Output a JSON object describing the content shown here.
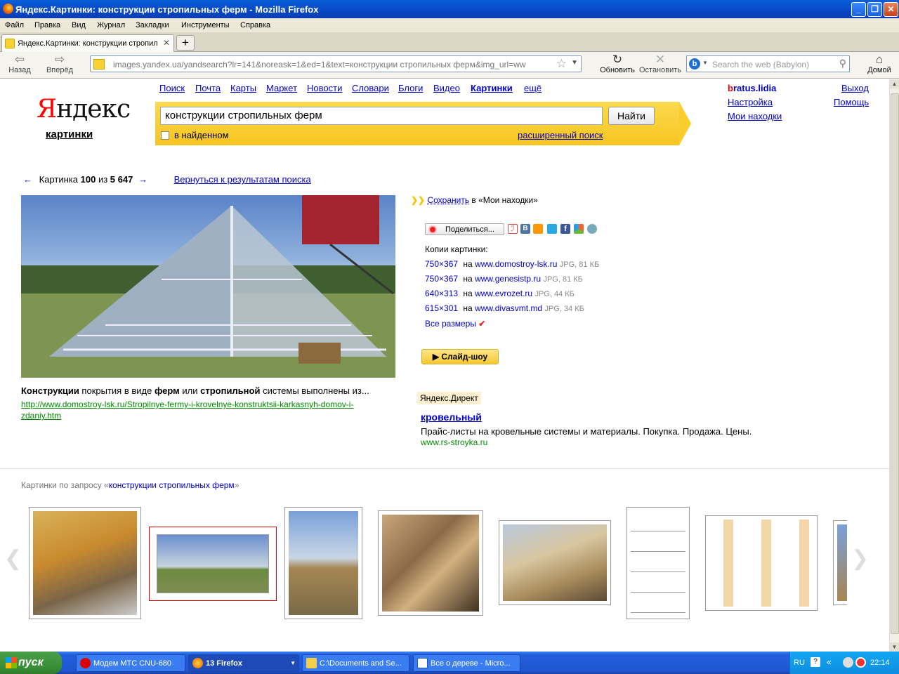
{
  "window": {
    "title": "Яндекс.Картинки: конструкции стропильных ферм - Mozilla Firefox",
    "btn_min": "_",
    "btn_max": "❐",
    "btn_close": "✕"
  },
  "menu": [
    "Файл",
    "Правка",
    "Вид",
    "Журнал",
    "Закладки",
    "Инструменты",
    "Справка"
  ],
  "tab": {
    "title": "Яндекс.Картинки: конструкции стропиль...",
    "close": "✕",
    "newtab": "+"
  },
  "nav": {
    "back": "Назад",
    "forward": "Вперёд",
    "url": "images.yandex.ua/yandsearch?lr=141&noreask=1&ed=1&text=конструкции стропильных ферм&img_url=ww",
    "reload": "Обновить",
    "stop": "Остановить",
    "search_placeholder": "Search the web (Babylon)",
    "home": "Домой"
  },
  "yandex": {
    "logo_first": "Я",
    "logo_rest": "ндекс",
    "section": "картинки",
    "services": [
      "Поиск",
      "Почта",
      "Карты",
      "Маркет",
      "Новости",
      "Словари",
      "Блоги",
      "Видео",
      "Картинки",
      "ещё"
    ],
    "query": "конструкции стропильных ферм",
    "find": "Найти",
    "in_found": "в найденном",
    "advanced": "расширенный поиск",
    "user_first": "b",
    "user_rest": "ratus.lidia",
    "settings": "Настройка",
    "my_finds": "Мои находки",
    "logout": "Выход",
    "help": "Помощь"
  },
  "pager": {
    "prev": "←",
    "label": "Картинка",
    "current": "100",
    "of": "из",
    "total": "5 647",
    "next": "→",
    "back_link": "Вернуться к результатам поиска"
  },
  "caption": {
    "b1": "Конструкции",
    "t1": " покрытия в виде ",
    "b2": "ферм",
    "t2": " или ",
    "b3": "стропильной",
    "t3": " системы выполнены из...",
    "url": "http://www.domostroy-lsk.ru/Stropilnye-fermy-i-krovelnye-konstruktsii-karkasnyh-domov-i-zdaniy.htm"
  },
  "save": {
    "link": "Сохранить",
    "rest": " в «Мои находки»"
  },
  "share": {
    "label": "Поделиться..."
  },
  "copies": {
    "title": "Копии картинки:",
    "items": [
      {
        "size": "750×367",
        "on": "на",
        "site": "www.domostroy-lsk.ru",
        "meta": "JPG, 81 КБ"
      },
      {
        "size": "750×367",
        "on": "на",
        "site": "www.genesistp.ru",
        "meta": "JPG, 81 КБ"
      },
      {
        "size": "640×313",
        "on": "на",
        "site": "www.evrozet.ru",
        "meta": "JPG, 44 КБ"
      },
      {
        "size": "615×301",
        "on": "на",
        "site": "www.divasvmt.md",
        "meta": "JPG, 34 КБ"
      }
    ],
    "all": "Все размеры"
  },
  "slideshow": "▶ Слайд-шоу",
  "direct": {
    "label": "Яндекс.Директ",
    "title": "кровельный",
    "text": "Прайс-листы на кровельные системы и материалы. Покупка. Продажа. Цены.",
    "url": "www.rs-stroyka.ru"
  },
  "related": {
    "prefix": "Картинки по запросу «",
    "query": "конструкции стропильных ферм",
    "suffix": "»"
  },
  "taskbar": {
    "start": "пуск",
    "tasks": [
      "Модем МТС CNU-680",
      "13 Firefox",
      "C:\\Documents and Se...",
      "Все о дереве - Micro..."
    ],
    "lang": "RU",
    "time": "22:14"
  },
  "colors": {
    "accent_yellow": "#f7c520",
    "link": "#0000cc",
    "green_url": "#008000",
    "red": "#ff0000"
  }
}
